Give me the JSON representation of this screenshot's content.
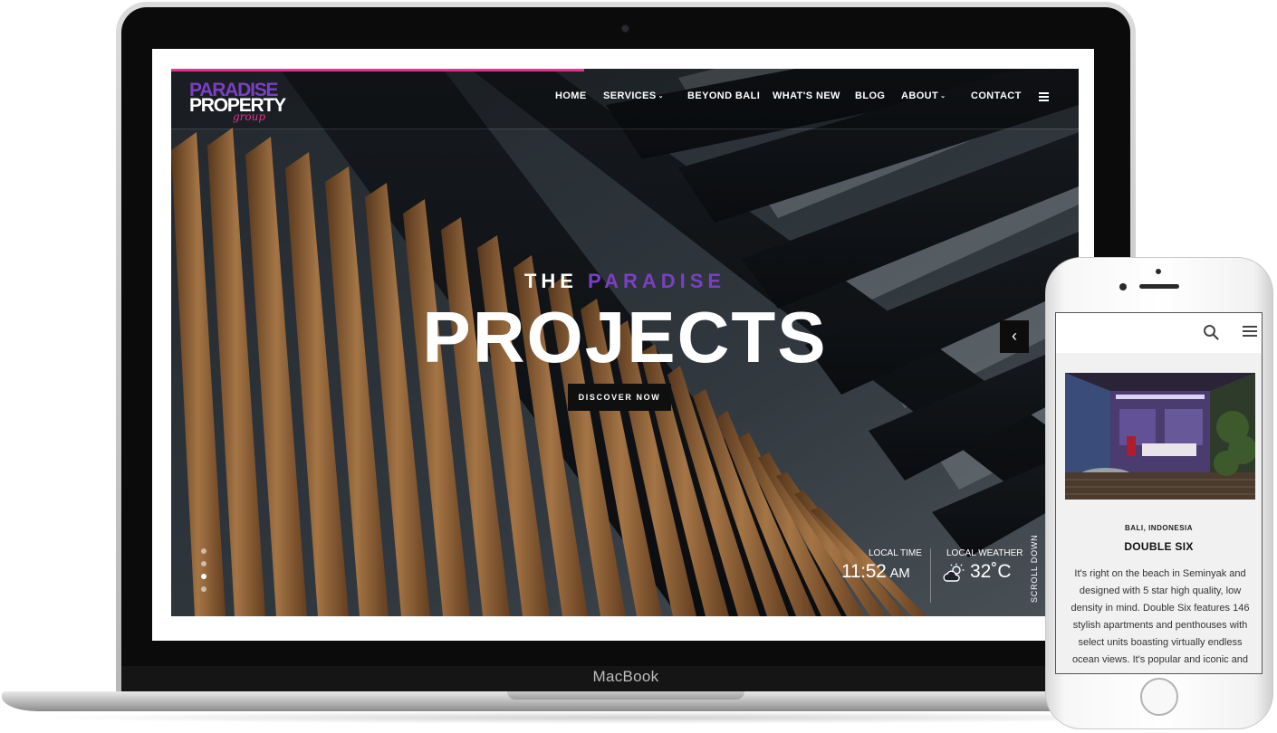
{
  "device_laptop": {
    "label": "MacBook"
  },
  "site": {
    "logo": {
      "line1": "PARADISE",
      "line2": "PROPERTY",
      "line3": "group"
    },
    "nav": [
      {
        "label": "HOME",
        "has_dropdown": false
      },
      {
        "label": "SERVICES",
        "has_dropdown": true
      },
      {
        "label": "BEYOND BALI",
        "has_dropdown": false
      },
      {
        "label": "WHAT'S NEW",
        "has_dropdown": false
      },
      {
        "label": "BLOG",
        "has_dropdown": false
      },
      {
        "label": "ABOUT",
        "has_dropdown": true
      },
      {
        "label": "CONTACT",
        "has_dropdown": false
      }
    ],
    "hero": {
      "kicker_prefix": "THE",
      "kicker_accent": "PARADISE",
      "title": "PROJECTS",
      "cta": "DISCOVER NOW",
      "slide_count": 4,
      "active_slide": 3
    },
    "info": {
      "time_label": "LOCAL TIME",
      "time_value": "11:52",
      "time_suffix": "AM",
      "weather_label": "LOCAL WEATHER",
      "weather_value": "32˚C",
      "weather_icon": "partly-cloudy-icon"
    },
    "scroll_down": "SCROLL DOWN"
  },
  "mobile": {
    "location": "BALI, INDONESIA",
    "title": "DOUBLE SIX",
    "body": "It's right on the beach in Seminyak and designed with 5 star high quality, low density in mind. Double Six features 146 stylish apartments and penthouses with select units boasting virtually endless ocean views. It's popular and iconic and"
  },
  "colors": {
    "accent_purple": "#7b3fc4",
    "accent_pink": "#e0348e",
    "cta_bg": "#0f0f0f"
  }
}
